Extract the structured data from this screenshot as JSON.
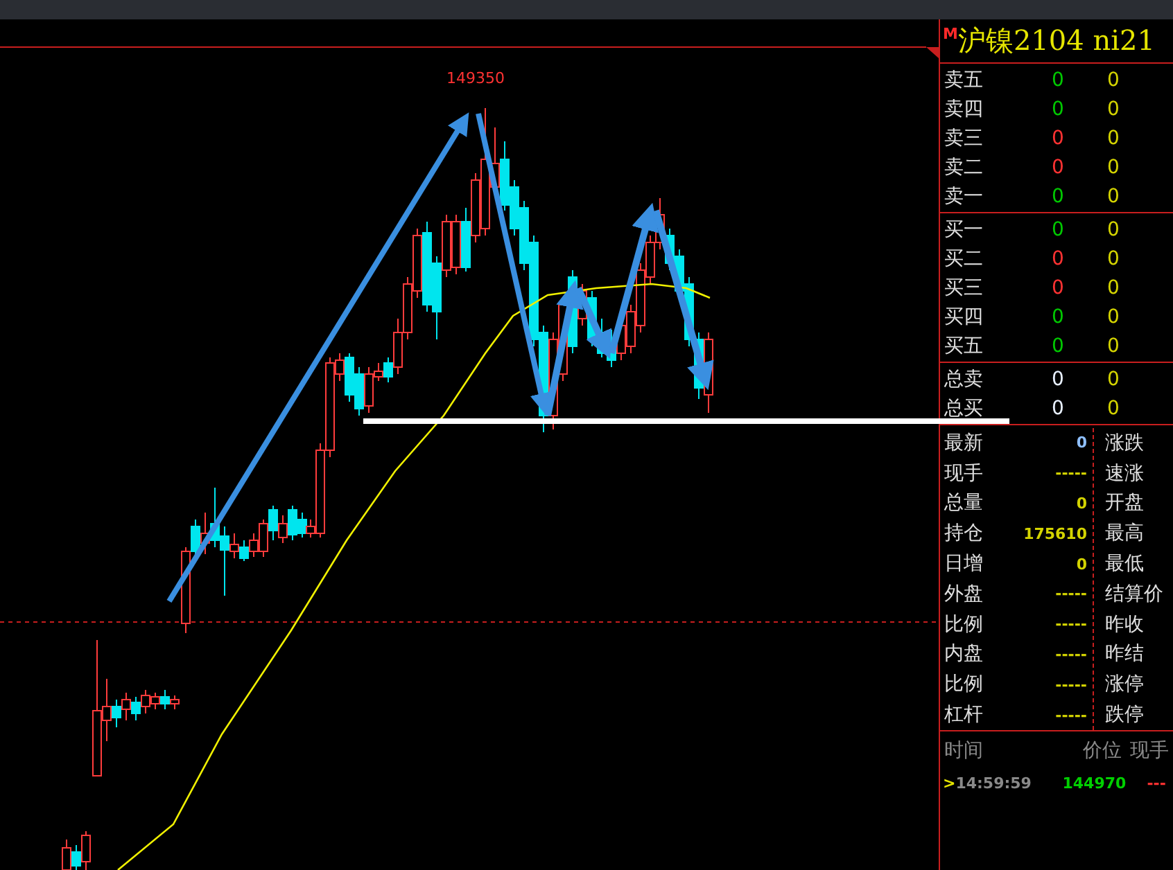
{
  "chart": {
    "peak_label": "149350"
  },
  "quote": {
    "badge": "M",
    "title": "沪镍2104 ni21",
    "asks": [
      {
        "label": "卖五",
        "price": "0",
        "volume": "0",
        "color": "#00c800"
      },
      {
        "label": "卖四",
        "price": "0",
        "volume": "0",
        "color": "#00c800"
      },
      {
        "label": "卖三",
        "price": "0",
        "volume": "0",
        "color": "#ff3232"
      },
      {
        "label": "卖二",
        "price": "0",
        "volume": "0",
        "color": "#ff3232"
      },
      {
        "label": "卖一",
        "price": "0",
        "volume": "0",
        "color": "#00c800"
      }
    ],
    "bids": [
      {
        "label": "买一",
        "price": "0",
        "volume": "0",
        "color": "#00c800"
      },
      {
        "label": "买二",
        "price": "0",
        "volume": "0",
        "color": "#ff3232"
      },
      {
        "label": "买三",
        "price": "0",
        "volume": "0",
        "color": "#ff3232"
      },
      {
        "label": "买四",
        "price": "0",
        "volume": "0",
        "color": "#00c800"
      },
      {
        "label": "买五",
        "price": "0",
        "volume": "0",
        "color": "#00c800"
      }
    ],
    "totals": [
      {
        "label": "总卖",
        "price": "0",
        "volume": "0"
      },
      {
        "label": "总买",
        "price": "0",
        "volume": "0"
      }
    ],
    "stats": [
      {
        "label": "最新",
        "value": "0",
        "color": "#8fc0ff",
        "right_label": "涨跌"
      },
      {
        "label": "现手",
        "value": "-----",
        "color": "#d4d400",
        "right_label": "速涨"
      },
      {
        "label": "总量",
        "value": "0",
        "color": "#d4d400",
        "right_label": "开盘"
      },
      {
        "label": "持仓",
        "value": "175610",
        "color": "#d4d400",
        "right_label": "最高"
      },
      {
        "label": "日增",
        "value": "0",
        "color": "#d4d400",
        "right_label": "最低"
      },
      {
        "label": "外盘",
        "value": "-----",
        "color": "#d4d400",
        "right_label": "结算价"
      },
      {
        "label": "比例",
        "value": "-----",
        "color": "#d4d400",
        "right_label": "昨收"
      },
      {
        "label": "内盘",
        "value": "-----",
        "color": "#d4d400",
        "right_label": "昨结"
      },
      {
        "label": "比例",
        "value": "-----",
        "color": "#d4d400",
        "right_label": "涨停"
      },
      {
        "label": "杠杆",
        "value": "-----",
        "color": "#d4d400",
        "right_label": "跌停"
      }
    ],
    "ticks": {
      "columns": [
        "时间",
        "价位",
        "现手"
      ],
      "rows": [
        {
          "marker": ">",
          "time": "14:59:59",
          "price": "144970",
          "volume": "---"
        }
      ]
    }
  }
}
